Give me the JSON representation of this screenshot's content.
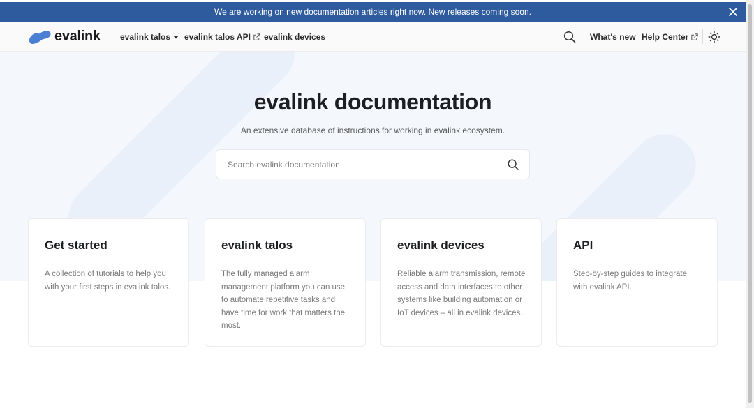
{
  "announcement": {
    "text": "We are working on new documentation articles right now. New releases coming soon.",
    "close_icon": "close-icon"
  },
  "navbar": {
    "logo_text": "evalink",
    "items": [
      {
        "label": "evalink talos",
        "icon": "caret-down-icon"
      },
      {
        "label": "evalink talos API",
        "icon": "external-link-icon"
      },
      {
        "label": "evalink devices"
      }
    ],
    "right_items": [
      {
        "label": "What's new"
      },
      {
        "label": "Help Center",
        "icon": "external-link-icon"
      }
    ],
    "search_icon": "search-icon",
    "theme_icon": "sun-icon"
  },
  "hero": {
    "title": "evalink documentation",
    "subtitle": "An extensive database of instructions for working in evalink ecosystem.",
    "search_placeholder": "Search evalink documentation",
    "search_value": ""
  },
  "cards": [
    {
      "title": "Get started",
      "description": "A collection of tutorials to help you with your first steps in evalink talos."
    },
    {
      "title": "evalink talos",
      "description": "The fully managed alarm management platform you can use to automate repetitive tasks and have time for work that matters the most."
    },
    {
      "title": "evalink devices",
      "description": "Reliable alarm transmission, remote access and data interfaces to other systems like building automation or IoT devices – all in evalink devices."
    },
    {
      "title": "API",
      "description": "Step-by-step guides to integrate with evalink API."
    }
  ],
  "colors": {
    "announcement_bg": "#2e5a9e",
    "logo_blue": "#4a7fd4",
    "hero_bg": "#f4f7fc"
  }
}
